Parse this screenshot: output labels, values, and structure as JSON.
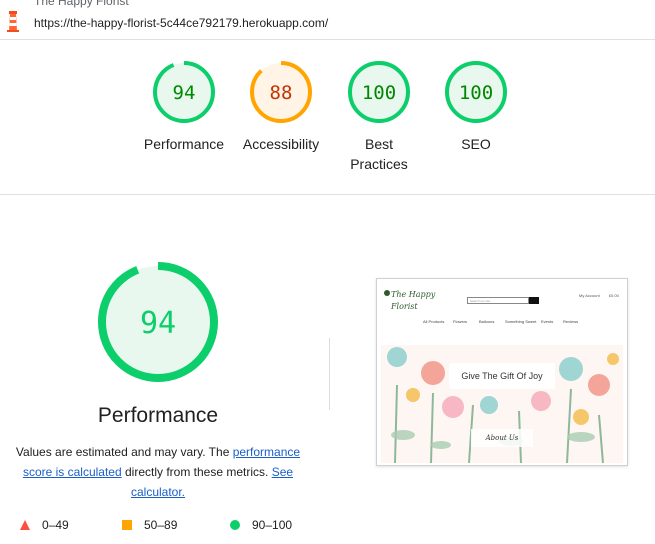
{
  "header": {
    "teaser_text": "The Happy Florist",
    "url": "https://the-happy-florist-5c44ce792179.herokuapp.com/"
  },
  "categories": [
    {
      "name": "Performance",
      "score": 94,
      "band": "pass"
    },
    {
      "name": "Accessibility",
      "score": 88,
      "band": "average"
    },
    {
      "name": "Best Practices",
      "score": 100,
      "band": "pass"
    },
    {
      "name": "SEO",
      "score": 100,
      "band": "pass"
    }
  ],
  "colors": {
    "pass": "#0cce6b",
    "pass_text": "#008800",
    "pass_fill": "#e8f8ee",
    "average": "#ffa400",
    "average_text": "#c33300",
    "average_fill": "#fff4e5",
    "fail": "#ff4e42",
    "link": "#1a5fc8"
  },
  "performance": {
    "score": 94,
    "title": "Performance",
    "desc_prefix": "Values are estimated and may vary. The ",
    "desc_link1": "performance score is calculated",
    "desc_middle": " directly from these metrics. ",
    "desc_link2": "See calculator."
  },
  "legend": [
    {
      "range": "0–49",
      "icon": "red-triangle-icon"
    },
    {
      "range": "50–89",
      "icon": "orange-square-icon"
    },
    {
      "range": "90–100",
      "icon": "green-circle-icon"
    }
  ],
  "screenshot": {
    "logo_line1": "The Happy",
    "logo_line2": "Florist",
    "search_placeholder": "Search our site",
    "account_label": "My Account",
    "bag_label": "£0.00",
    "nav": [
      "All Products",
      "Flowers",
      "Balloons",
      "Something Sweet",
      "Events",
      "Reviews"
    ],
    "banner": "Give The Gift Of Joy",
    "about": "About Us"
  }
}
